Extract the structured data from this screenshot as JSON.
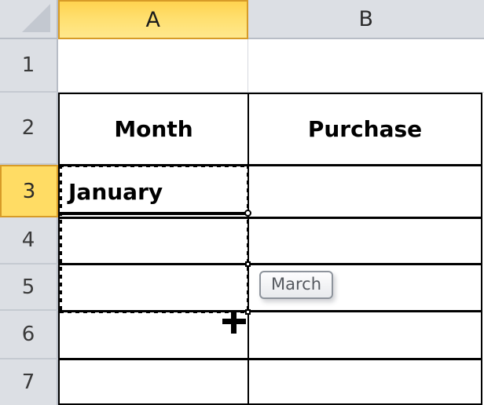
{
  "app": {
    "kind": "spreadsheet",
    "select_all_label": "Select All"
  },
  "colors": {
    "header_background": "#DCDFE4",
    "header_selected_background": "#FFDC64",
    "header_selected_border": "#D79B28",
    "grid_line": "#D6D9DE",
    "table_border": "#000000",
    "tooltip_text": "#55595F"
  },
  "columns": [
    {
      "label": "A",
      "selected": true
    },
    {
      "label": "B",
      "selected": false
    }
  ],
  "rows": [
    {
      "label": "1",
      "selected": false
    },
    {
      "label": "2",
      "selected": false
    },
    {
      "label": "3",
      "selected": true
    },
    {
      "label": "4",
      "selected": false
    },
    {
      "label": "5",
      "selected": false
    },
    {
      "label": "6",
      "selected": false
    },
    {
      "label": "7",
      "selected": false
    }
  ],
  "cells": {
    "a1": "",
    "b1": "",
    "a2": "Month",
    "b2": "Purchase",
    "a3": "January",
    "b3": "",
    "a4": "",
    "b4": "",
    "a5": "",
    "b5": "",
    "a6": "",
    "b6": "",
    "a7": "",
    "b7": ""
  },
  "selection": {
    "active_cell": "A3",
    "fill_range": "A3:A5",
    "cursor": "fill-handle-crosshair"
  },
  "tooltip": {
    "text": "March"
  }
}
